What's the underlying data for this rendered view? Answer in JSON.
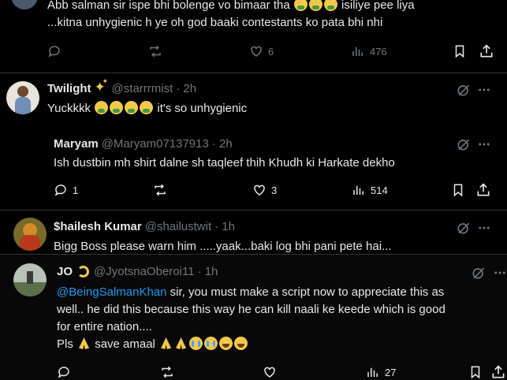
{
  "tweet1": {
    "line1": "Abb salman sir ispe bhi bolenge vo bimaar tha",
    "line1_suffix": "isiliye pee liya",
    "line2": "...kitna unhygienic h ye oh god baaki contestants ko pata bhi nhi",
    "likes": "6",
    "views": "476"
  },
  "tweet2": {
    "name": "Twilight",
    "handle": "@starrrmist",
    "time": "· 2h",
    "text_start": "Yuckkkk",
    "text_end": "it's so unhygienic"
  },
  "tweet3": {
    "name": "Maryam",
    "handle": "@Maryam07137913",
    "time": "· 2h",
    "text": "Ish dustbin mh shirt dalne sh taqleef thih Khudh ki Harkate dekho",
    "replies": "1",
    "likes": "3",
    "views": "514"
  },
  "tweet4": {
    "name": "$hailesh Kumar",
    "handle": "@shailustwit",
    "time": "· 1h",
    "text": "Bigg Boss please warn him .....yaak...baki log bhi pani pete hai..."
  },
  "tweet5": {
    "name": "JO",
    "handle": "@JyotsnaOberoi11",
    "time": "· 1h",
    "mention": "@BeingSalmanKhan",
    "line1_rest": " sir, you must make a script now to appreciate this as",
    "line2": "well.. he did this because this way he can kill naali ke keede which is good",
    "line3": "for entire nation....",
    "line4_start": "Pls",
    "line4_mid": "save amaal",
    "views": "27"
  },
  "colors": {
    "background": "#000000",
    "text": "#e7e9ea",
    "muted": "#71767b",
    "link": "#1d9bf0",
    "divider": "#2f3336",
    "hover_background": "#080808"
  },
  "icons": [
    "reply-icon",
    "retweet-icon",
    "like-icon",
    "views-icon",
    "bookmark-icon",
    "share-icon",
    "grok-icon",
    "more-icon"
  ]
}
